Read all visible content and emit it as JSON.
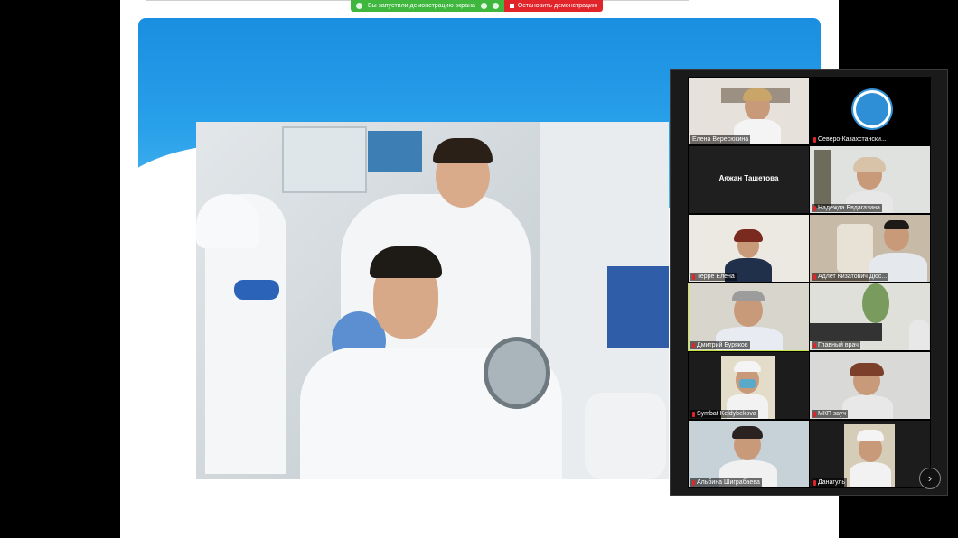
{
  "share_toolbar": {
    "status_text": "Вы запустили демонстрацию экрана",
    "stop_label": "Остановить демонстрацию",
    "status_color": "#3fb73f",
    "stop_color": "#e0242a"
  },
  "participants": [
    {
      "name": "Елена Вересюкина",
      "muted": false
    },
    {
      "name": "Северо-Казахстански...",
      "muted": true
    },
    {
      "name": "Аяжан Ташетова",
      "muted": false,
      "camera_off": true
    },
    {
      "name": "Надежда Евдагазина",
      "muted": true
    },
    {
      "name": "Терре Елена",
      "muted": true
    },
    {
      "name": "Адлет Кизатович Дюс...",
      "muted": true
    },
    {
      "name": "Дмитрий Буряков",
      "muted": true,
      "active_speaker": true
    },
    {
      "name": "Главный врач",
      "muted": true
    },
    {
      "name": "Symbat Keldybekova",
      "muted": true
    },
    {
      "name": "МКП зауч",
      "muted": true
    },
    {
      "name": "Альбина Шиграбаева",
      "muted": true
    },
    {
      "name": "Данагуль",
      "muted": true
    }
  ],
  "next_page_icon": "chevron-right-icon",
  "colors": {
    "banner": "#1a8ee0",
    "active_border": "#c8e64a",
    "panel_bg": "#1a1a1a"
  }
}
